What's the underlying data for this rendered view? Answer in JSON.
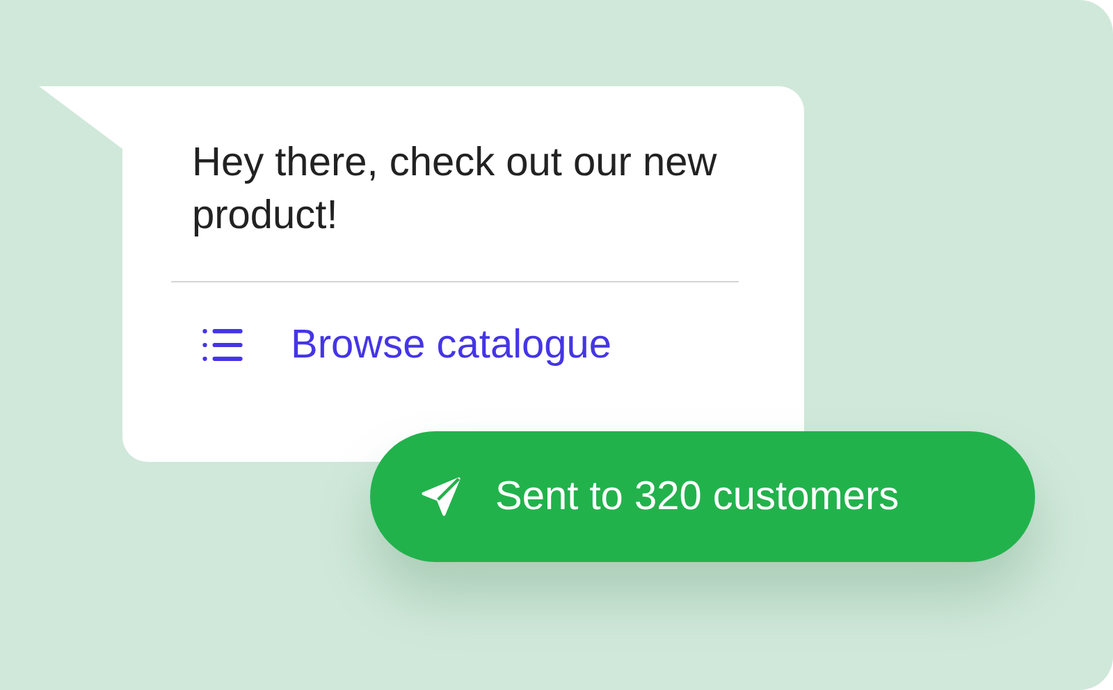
{
  "message": {
    "text": "Hey there, check out our new product!"
  },
  "action": {
    "label": "Browse catalogue"
  },
  "status": {
    "label": "Sent to 320 customers"
  }
}
